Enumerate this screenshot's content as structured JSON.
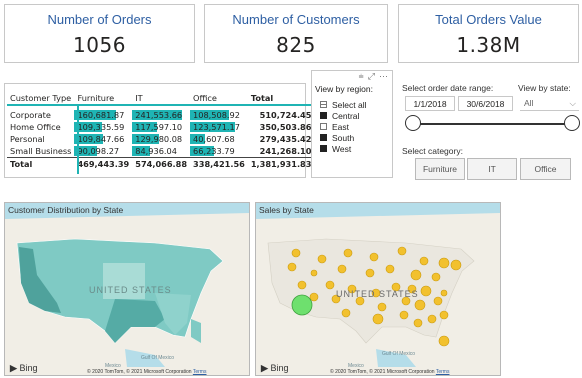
{
  "cards": [
    {
      "title": "Number of Orders",
      "value": "1056"
    },
    {
      "title": "Number of Customers",
      "value": "825"
    },
    {
      "title": "Total Orders Value",
      "value": "1.38M"
    }
  ],
  "matrix": {
    "headers": [
      "Customer Type",
      "Furniture",
      "IT",
      "Office",
      "Total"
    ],
    "rows": [
      {
        "label": "Corporate",
        "furniture": "160,681.87",
        "it": "241,553.66",
        "office": "108,508.92",
        "total": "510,724.45",
        "bars": [
          0.83,
          1.0,
          0.78
        ]
      },
      {
        "label": "Home Office",
        "furniture": "109,335.59",
        "it": "117,597.10",
        "office": "123,571.17",
        "total": "350,503.86",
        "bars": [
          0.56,
          0.49,
          0.89
        ]
      },
      {
        "label": "Personal",
        "furniture": "109,847.66",
        "it": "129,980.08",
        "office": "40,607.68",
        "total": "279,435.42",
        "bars": [
          0.57,
          0.54,
          0.29
        ]
      },
      {
        "label": "Small Business",
        "furniture": "90,098.27",
        "it": "84,936.04",
        "office": "66,233.79",
        "total": "241,268.10",
        "bars": [
          0.46,
          0.35,
          0.48
        ]
      }
    ],
    "total": {
      "label": "Total",
      "furniture": "469,443.39",
      "it": "574,066.88",
      "office": "338,421.56",
      "total": "1,381,931.83"
    }
  },
  "region_slicer": {
    "title": "View by region:",
    "items": [
      {
        "label": "Select all",
        "state": "partial"
      },
      {
        "label": "Central",
        "state": "checked"
      },
      {
        "label": "East",
        "state": "unchecked"
      },
      {
        "label": "South",
        "state": "checked"
      },
      {
        "label": "West",
        "state": "checked"
      }
    ]
  },
  "date_slicer": {
    "label": "Select order date range:",
    "start": "1/1/2018",
    "end": "30/6/2018"
  },
  "state_slicer": {
    "label": "View by state:",
    "value": "All"
  },
  "category": {
    "label": "Select category:",
    "buttons": [
      "Furniture",
      "IT",
      "Office"
    ]
  },
  "map_left": {
    "title": "Customer Distribution by State",
    "country_label": "UNITED STATES",
    "gulf_label": "Gulf Of Mexico",
    "mexico_label": "Mexico",
    "bing": "Bing",
    "copyright": "© 2020 TomTom, © 2021 Microsoft Corporation",
    "terms": "Terms"
  },
  "map_right": {
    "title": "Sales by State",
    "country_label": "UNITED STATES",
    "gulf_label": "Gulf Of Mexico",
    "mexico_label": "Mexico",
    "bing": "Bing",
    "copyright": "© 2020 TomTom, © 2021 Microsoft Corporation",
    "terms": "Terms"
  },
  "colors": {
    "accent": "#1fb4b4",
    "card_title": "#2e5fa3",
    "map_water": "#b5dde9",
    "map_land": "#f1eee6",
    "choropleth": "#7fcac4",
    "bubble": "#f2c12e",
    "bubble_highlight": "#6ee06e"
  }
}
